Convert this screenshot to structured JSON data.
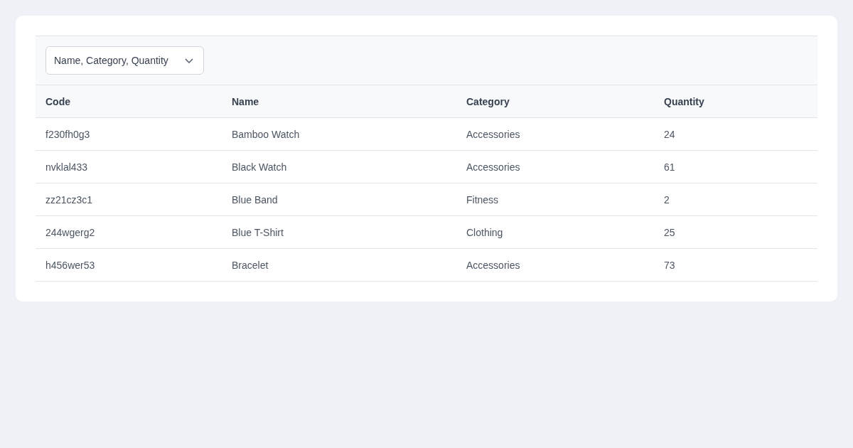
{
  "column_picker": {
    "value": "Name, Category, Quantity"
  },
  "table": {
    "columns": [
      "Code",
      "Name",
      "Category",
      "Quantity"
    ],
    "rows": [
      [
        "f230fh0g3",
        "Bamboo Watch",
        "Accessories",
        "24"
      ],
      [
        "nvklal433",
        "Black Watch",
        "Accessories",
        "61"
      ],
      [
        "zz21cz3c1",
        "Blue Band",
        "Fitness",
        "2"
      ],
      [
        "244wgerg2",
        "Blue T-Shirt",
        "Clothing",
        "25"
      ],
      [
        "h456wer53",
        "Bracelet",
        "Accessories",
        "73"
      ]
    ]
  }
}
